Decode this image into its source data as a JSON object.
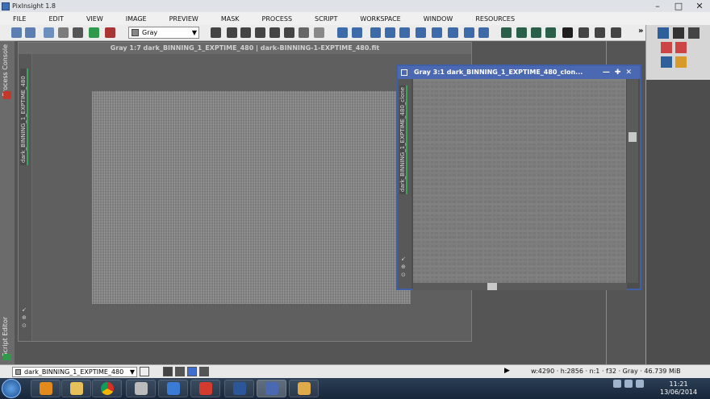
{
  "app": {
    "title": "PixInsight 1.8"
  },
  "menu": [
    "FILE",
    "EDIT",
    "VIEW",
    "IMAGE",
    "PREVIEW",
    "MASK",
    "PROCESS",
    "SCRIPT",
    "WORKSPACE",
    "WINDOW",
    "RESOURCES"
  ],
  "toolbar": {
    "color_mode": "Gray",
    "overflow": "»"
  },
  "left_strip": {
    "process_console": "Process Console",
    "script_editor": "Script Editor"
  },
  "main_window": {
    "title": "Gray 1:7 dark_BINNING_1_EXPTIME_480 | dark-BINNING-1-EXPTIME_480.fit",
    "tab": "dark_BINNING_1_EXPTIME_480"
  },
  "clone_window": {
    "title": "Gray 3:1 dark_BINNING_1_EXPTIME_480_clon...",
    "tab": "dark_BINNING_1_EXPTIME_480_clone"
  },
  "status": {
    "view": "dark_BINNING_1_EXPTIME_480",
    "info": "w:4290 · h:2856 · n:1 · f32 · Gray · 46.739 MiB"
  },
  "clock": {
    "time": "11:21",
    "date": "13/06/2014"
  },
  "colors": {
    "accent": "#4b68b3",
    "tab_marker": "#3aa65a",
    "workspace": "#555555"
  }
}
